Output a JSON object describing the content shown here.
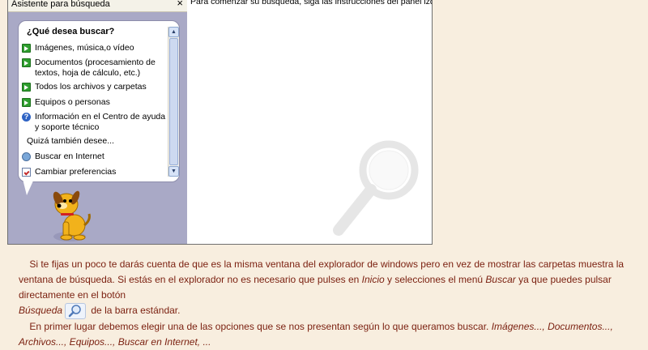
{
  "assistant": {
    "title": "Asistente para búsqueda",
    "close_label": "×",
    "question": "¿Qué desea buscar?",
    "options": [
      {
        "icon": "green-arrow-icon",
        "line1": "Imágenes, música,o vídeo",
        "line2": ""
      },
      {
        "icon": "green-arrow-icon",
        "line1": "Documentos (procesamiento de",
        "line2": "textos, hoja de cálculo, etc.)"
      },
      {
        "icon": "green-arrow-icon",
        "line1": "Todos los archivos y carpetas",
        "line2": ""
      },
      {
        "icon": "green-arrow-icon",
        "line1": "Equipos o personas",
        "line2": ""
      },
      {
        "icon": "help-icon",
        "line1": "Información en el Centro de ayuda",
        "line2": "y soporte técnico"
      }
    ],
    "maybe_label": "Quizá también desee...",
    "extra_options": [
      {
        "icon": "globe-search-icon",
        "label": "Buscar en Internet"
      },
      {
        "icon": "preferences-icon",
        "label": "Cambiar preferencias"
      }
    ]
  },
  "results": {
    "message": "Para comenzar su búsqueda, siga las instrucciones del panel izquierdo."
  },
  "article": {
    "p1_a": "Si te fijas un poco te darás cuenta de que es la misma ventana del explorador de windows pero en vez de mostrar las carpetas muestra la ventana de búsqueda. Si estás en el explorador no es necesario que pulses en ",
    "p1_inicio": "Inicio",
    "p1_b": " y selecciones el menú ",
    "p1_buscar": "Buscar",
    "p1_c": " ya que puedes pulsar directamente en el botón ",
    "p1_busqueda": "Búsqueda",
    "p1_d": " de la barra estándar.",
    "p2_a": "En primer lugar debemos elegir una de las opciones que se nos presentan según lo que queramos buscar. ",
    "p2_list": "Imágenes..., Documentos..., Archivos..., Equipos..., Buscar en Internet, ..."
  }
}
